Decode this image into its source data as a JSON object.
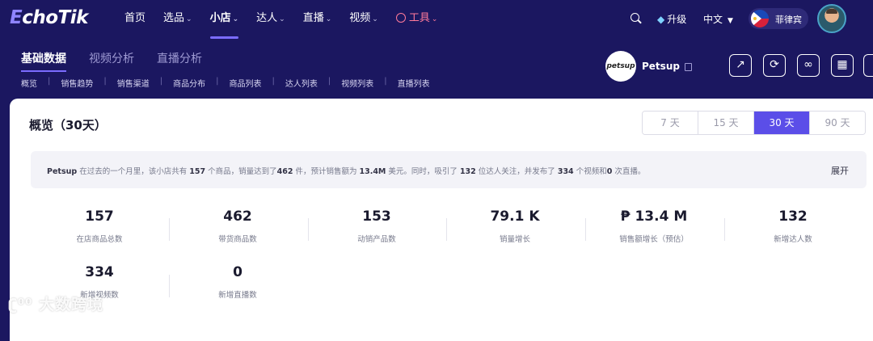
{
  "logo": {
    "prefix": "E",
    "rest": "choTik"
  },
  "nav": [
    {
      "label": "首页",
      "chevron": false
    },
    {
      "label": "选品",
      "chevron": true
    },
    {
      "label": "小店",
      "chevron": true
    },
    {
      "label": "达人",
      "chevron": true
    },
    {
      "label": "直播",
      "chevron": true
    },
    {
      "label": "视频",
      "chevron": true
    },
    {
      "label": "工具",
      "chevron": true
    }
  ],
  "topbar": {
    "upgrade": "升级",
    "language": "中文",
    "region": "菲律宾"
  },
  "tabs": [
    "基础数据",
    "视频分析",
    "直播分析"
  ],
  "subnav": [
    "概览",
    "销售趋势",
    "销售渠道",
    "商品分布",
    "商品列表",
    "达人列表",
    "视频列表",
    "直播列表"
  ],
  "shop": {
    "logo_text": "petsup",
    "name": "Petsup"
  },
  "overview": {
    "title": "概览（30天）",
    "ranges": [
      "7 天",
      "15 天",
      "30 天",
      "90 天"
    ],
    "active_range": "30 天",
    "summary": {
      "s1": "Petsup",
      "t1": " 在过去的一个月里，该小店共有 ",
      "s2": "157",
      "t2": " 个商品，销量达到了",
      "s3": "462",
      "t3": " 件，预计销售额为 ",
      "s4": "13.4M",
      "t4": " 美元。同时，吸引了 ",
      "s5": "132",
      "t5": " 位达人关注，并发布了 ",
      "s6": "334",
      "t6": " 个视频和",
      "s7": "0",
      "t7": " 次直播。"
    },
    "expand": "展开",
    "stats": [
      {
        "value": "157",
        "label": "在店商品总数"
      },
      {
        "value": "462",
        "label": "带货商品数"
      },
      {
        "value": "153",
        "label": "动销产品数"
      },
      {
        "value": "79.1 K",
        "label": "销量增长"
      },
      {
        "value": "₱ 13.4 M",
        "label": "销售额增长（预估）"
      },
      {
        "value": "132",
        "label": "新增达人数"
      },
      {
        "value": "334",
        "label": "新增视频数"
      },
      {
        "value": "0",
        "label": "新增直播数"
      }
    ]
  },
  "watermark": "大数跨境",
  "colors": {
    "nav_bg": "#1b1760",
    "accent": "#5b4ee8",
    "tools": "#ff7a9a"
  }
}
